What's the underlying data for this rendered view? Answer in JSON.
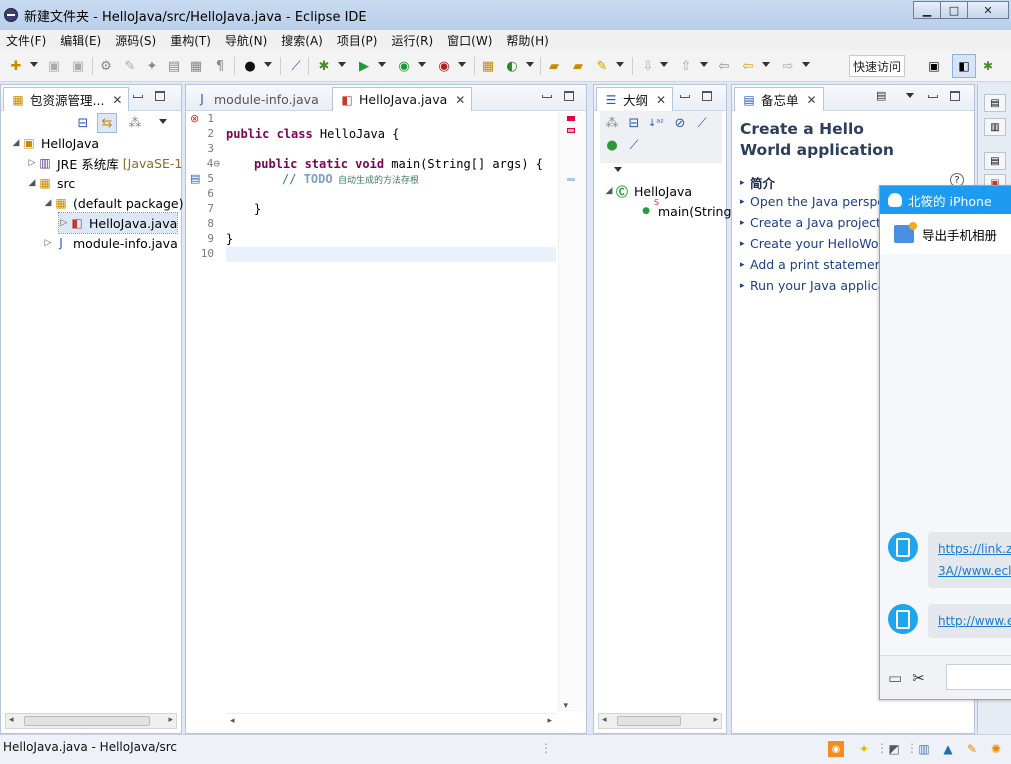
{
  "window": {
    "title": "新建文件夹 - HelloJava/src/HelloJava.java - Eclipse IDE"
  },
  "menubar": [
    {
      "label": "文件(F)"
    },
    {
      "label": "编辑(E)"
    },
    {
      "label": "源码(S)"
    },
    {
      "label": "重构(T)"
    },
    {
      "label": "导航(N)"
    },
    {
      "label": "搜索(A)"
    },
    {
      "label": "项目(P)"
    },
    {
      "label": "运行(R)"
    },
    {
      "label": "窗口(W)"
    },
    {
      "label": "帮助(H)"
    }
  ],
  "toolbar": {
    "quick_access": "快速访问"
  },
  "package_explorer": {
    "tab_label": "包资源管理...",
    "tree": [
      {
        "label": "HelloJava",
        "icon": "java-project-icon"
      },
      {
        "label": "JRE 系统库",
        "suffix": "[JavaSE-1",
        "icon": "library-icon"
      },
      {
        "label": "src",
        "icon": "source-folder-icon"
      },
      {
        "label": "(default package)",
        "icon": "package-icon"
      },
      {
        "label": "HelloJava.java",
        "icon": "java-file-icon"
      },
      {
        "label": "module-info.java",
        "icon": "java-file-icon"
      }
    ]
  },
  "editor": {
    "tabs": [
      {
        "label": "module-info.java",
        "active": false
      },
      {
        "label": "HelloJava.java",
        "active": true
      }
    ],
    "line_numbers": [
      "1",
      "2",
      "3",
      "4⊖",
      "5",
      "6",
      "7",
      "8",
      "9",
      "10"
    ],
    "code": {
      "l2_kw": "public class",
      "l2_rest": " HelloJava {",
      "l4_kw": "public static void",
      "l4_rest": " main(String[] args) {",
      "l5_comment": "// ",
      "l5_todo": "TODO",
      "l5_text": " 自动生成的方法存根",
      "l7": "}",
      "l9": "}"
    }
  },
  "outline": {
    "tab_label": "大纲",
    "tree": [
      {
        "label": "HelloJava",
        "icon": "class-icon"
      },
      {
        "label": "main(String",
        "icon": "method-icon",
        "modifier": "S"
      }
    ]
  },
  "cheat_sheet": {
    "tab_label": "备忘单",
    "title": "Create a Hello World application",
    "items": [
      {
        "label": "简介",
        "bold": true
      },
      {
        "label": "Open the Java perspe"
      },
      {
        "label": "Create a Java project"
      },
      {
        "label": "Create your HelloWor"
      },
      {
        "label": "Add a print statement"
      },
      {
        "label": "Run your Java applica"
      }
    ]
  },
  "qq_window": {
    "title": "北筱的 iPhone",
    "action": "导出手机相册",
    "messages": [
      {
        "line1": "https://link.z",
        "line2": "3A//www.ecl"
      },
      {
        "line1": "http://www.e",
        "line2": ""
      }
    ]
  },
  "statusbar": {
    "text": "HelloJava.java - HelloJava/src"
  },
  "colors": {
    "keyword": "#7f0055",
    "comment": "#3f7f5f",
    "todo": "#7f9fbf",
    "qq_blue": "#1d9bf0",
    "link": "#1a7bd1"
  }
}
